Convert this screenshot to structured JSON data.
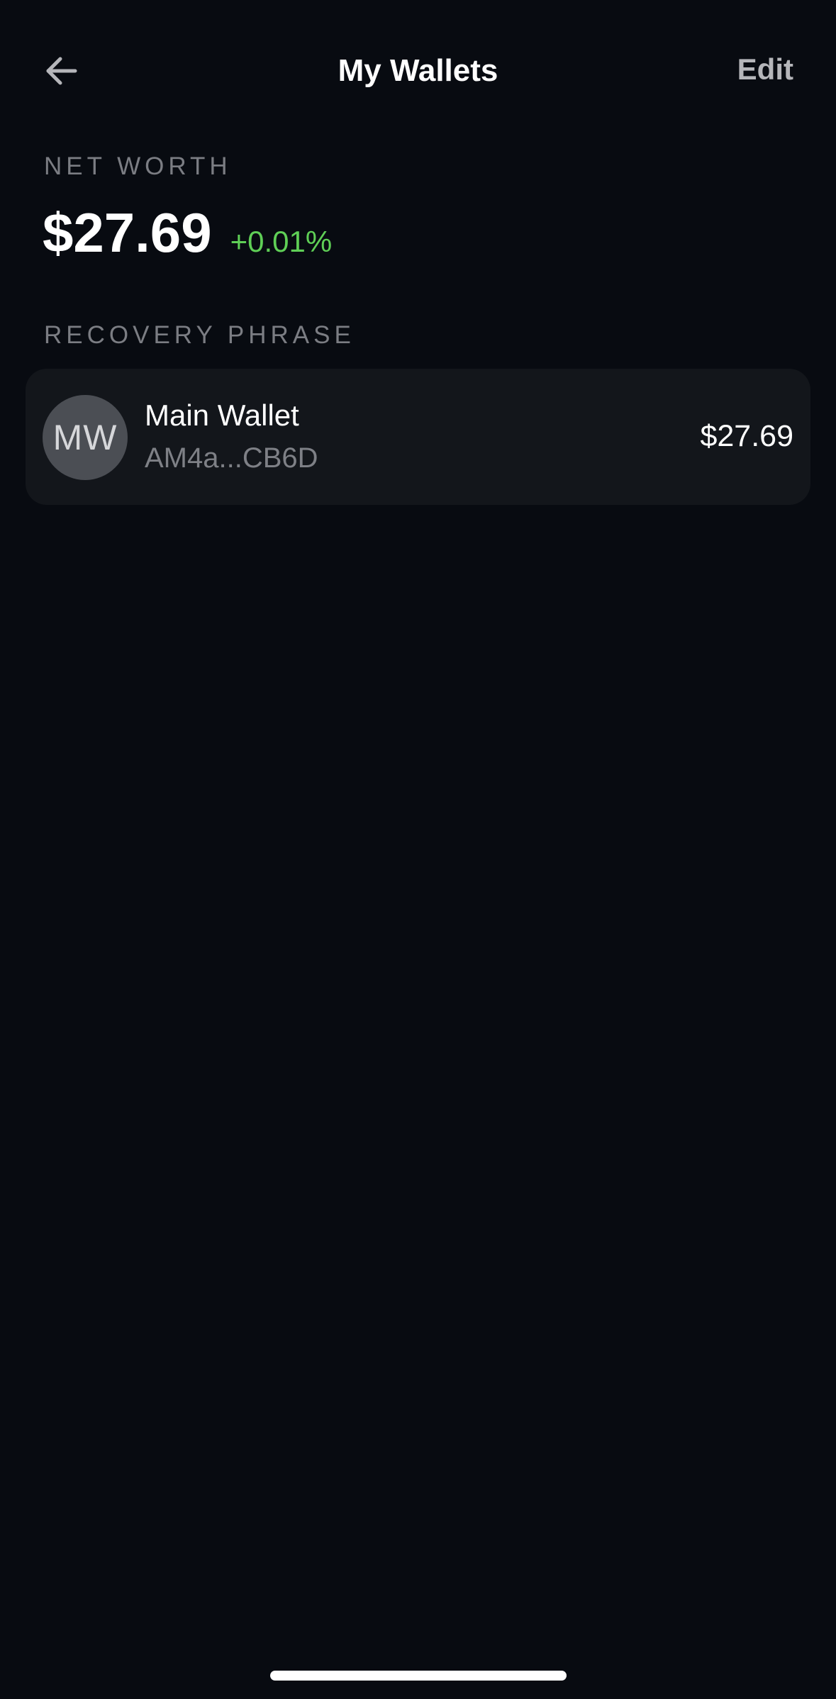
{
  "header": {
    "back_icon": "arrow-left-icon",
    "title": "My Wallets",
    "edit_label": "Edit"
  },
  "net_worth": {
    "label": "NET WORTH",
    "value": "$27.69",
    "change": "+0.01%",
    "change_color": "#5fcf56"
  },
  "recovery_phrase": {
    "label": "RECOVERY PHRASE",
    "wallets": [
      {
        "initials": "MW",
        "name": "Main Wallet",
        "address": "AM4a...CB6D",
        "balance": "$27.69"
      }
    ]
  },
  "colors": {
    "background": "#080b11",
    "card": "#13161b",
    "muted_text": "#7b7d83",
    "positive": "#5fcf56"
  }
}
